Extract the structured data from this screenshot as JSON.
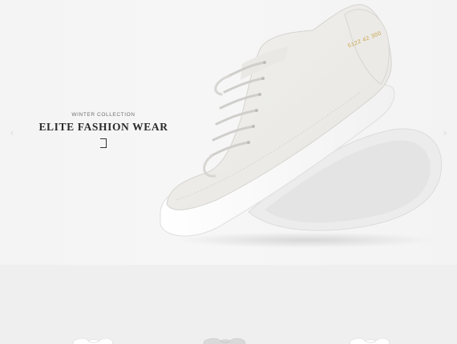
{
  "hero": {
    "subtitle": "WINTER COLLECTION",
    "title": "ELITE FASHION WEAR",
    "image_icon": "sneaker-image",
    "serial_text": "5122 42 300",
    "prev_icon": "chevron-left-icon",
    "next_icon": "chevron-right-icon",
    "prev_glyph": "‹",
    "next_glyph": "›",
    "button_icon": "bracket-button-icon"
  },
  "featured": {
    "products": [
      {
        "icon": "tshirt-image"
      },
      {
        "icon": "tshirt-image"
      },
      {
        "icon": "tshirt-image"
      }
    ]
  },
  "colors": {
    "hero_bg": "#f4f4f4",
    "section_bg": "#efefef",
    "text_dark": "#2b2b2b",
    "text_muted": "#6e6e6e",
    "accent_gold": "#c9a24a"
  }
}
